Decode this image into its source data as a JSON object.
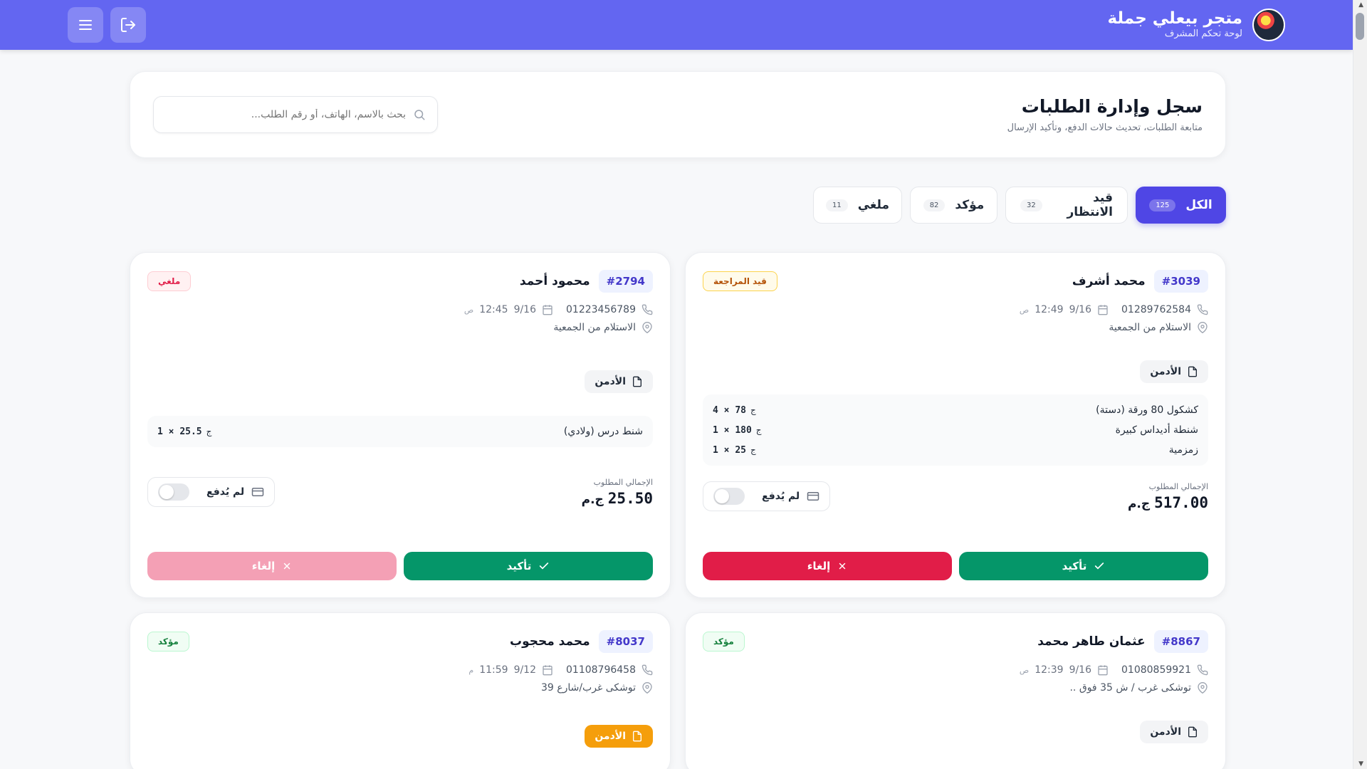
{
  "brand": {
    "title": "متجر بيعلي جملة",
    "subtitle": "لوحة تحكم المشرف"
  },
  "icons": {
    "logout": "logout-icon",
    "menu": "menu-icon",
    "search": "search-icon",
    "phone": "phone-icon",
    "calendar": "calendar-icon",
    "location": "location-icon",
    "file": "file-icon",
    "card": "credit-card-icon",
    "check": "check-icon",
    "close": "close-icon"
  },
  "colors": {
    "accent": "#6366f1",
    "active_tab": "#4f46e5",
    "confirm": "#059669",
    "cancel": "#e11d48"
  },
  "header": {
    "title": "سجل وإدارة الطلبات",
    "subtitle": "متابعة الطلبات، تحديث حالات الدفع، وتأكيد الإرسال",
    "search_placeholder": "بحث بالاسم، الهاتف، أو رقم الطلب..."
  },
  "tabs": [
    {
      "label": "الكل",
      "count": "125",
      "active": true
    },
    {
      "label": "قيد الانتظار",
      "count": "32"
    },
    {
      "label": "مؤكد",
      "count": "82"
    },
    {
      "label": "ملغي",
      "count": "11"
    }
  ],
  "orders": [
    {
      "id": "#3039",
      "customer": "محمد أشرف",
      "status": "قيد المراجعة",
      "phone": "01289762584",
      "date": "9/16",
      "time": "12:49",
      "ampm": "ص",
      "location": "الاستلام من الجمعية",
      "admin": "الأدمن",
      "items": [
        {
          "name": "كشكول 80 ورقة (دستة)",
          "qty": "4",
          "price": "78",
          "cur": "ج"
        },
        {
          "name": "شنطة أديداس كبيرة",
          "qty": "1",
          "price": "180",
          "cur": "ج"
        },
        {
          "name": "زمزمية",
          "qty": "1",
          "price": "25",
          "cur": "ج"
        }
      ],
      "total_label": "الإجمالي المطلوب",
      "total": "517.00",
      "currency": "ج.م",
      "payment": "لم يُدفع",
      "confirm_label": "تأكيد",
      "cancel_label": "إلغاء"
    },
    {
      "id": "#2794",
      "customer": "محمود أحمد",
      "status": "ملغي",
      "phone": "01223456789",
      "date": "9/16",
      "time": "12:45",
      "ampm": "ص",
      "location": "الاستلام من الجمعية",
      "admin": "الأدمن",
      "items": [
        {
          "name": "شنط درس (ولادي)",
          "qty": "1",
          "price": "25.5",
          "cur": "ج"
        }
      ],
      "total_label": "الإجمالي المطلوب",
      "total": "25.50",
      "currency": "ج.م",
      "payment": "لم يُدفع",
      "confirm_label": "تأكيد",
      "cancel_label": "إلغاء"
    },
    {
      "id": "#8867",
      "customer": "عثمان طاهر محمد",
      "status": "مؤكد",
      "phone": "01080859921",
      "date": "9/16",
      "time": "12:39",
      "ampm": "ص",
      "location": "توشكى غرب / ش 35 فوق ..",
      "admin": "الأدمن"
    },
    {
      "id": "#8037",
      "customer": "محمد محجوب",
      "status": "مؤكد",
      "phone": "01108796458",
      "date": "9/12",
      "time": "11:59",
      "ampm": "م",
      "location": "توشكى غرب/شارع 39",
      "admin": "الأدمن"
    }
  ]
}
